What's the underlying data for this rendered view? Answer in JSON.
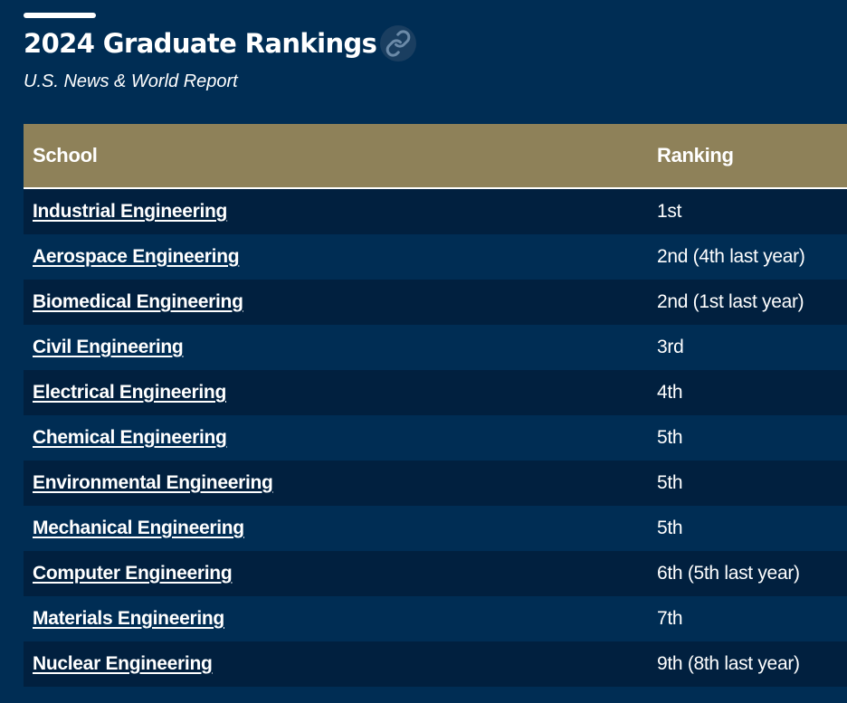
{
  "header": {
    "title": "2024 Graduate Rankings",
    "subtitle": "U.S. News & World Report",
    "link_icon": "link-icon"
  },
  "table": {
    "headers": {
      "school": "School",
      "ranking": "Ranking"
    },
    "rows": [
      {
        "school": "Industrial Engineering",
        "ranking": "1st"
      },
      {
        "school": "Aerospace Engineering",
        "ranking": "2nd (4th last year)"
      },
      {
        "school": "Biomedical Engineering",
        "ranking": "2nd (1st last year)"
      },
      {
        "school": "Civil Engineering",
        "ranking": "3rd"
      },
      {
        "school": "Electrical Engineering",
        "ranking": "4th"
      },
      {
        "school": "Chemical Engineering",
        "ranking": "5th"
      },
      {
        "school": "Environmental Engineering",
        "ranking": "5th"
      },
      {
        "school": "Mechanical Engineering",
        "ranking": "5th"
      },
      {
        "school": "Computer Engineering",
        "ranking": "6th (5th last year)"
      },
      {
        "school": "Materials Engineering",
        "ranking": "7th"
      },
      {
        "school": "Nuclear Engineering",
        "ranking": "9th (8th last year)"
      }
    ]
  },
  "colors": {
    "background": "#002d54",
    "header_gold": "#8e8159",
    "row_dark": "#01203f"
  }
}
